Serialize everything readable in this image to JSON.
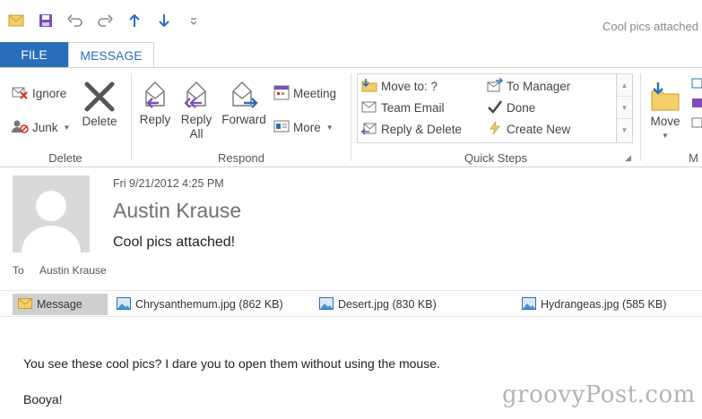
{
  "window": {
    "title": "Cool pics attached"
  },
  "tabs": {
    "file": "FILE",
    "message": "MESSAGE"
  },
  "ribbon": {
    "delete_group": {
      "label": "Delete",
      "ignore": "Ignore",
      "junk": "Junk",
      "delete": "Delete"
    },
    "respond_group": {
      "label": "Respond",
      "reply": "Reply",
      "reply_all_1": "Reply",
      "reply_all_2": "All",
      "forward": "Forward",
      "meeting": "Meeting",
      "more": "More"
    },
    "quick_steps": {
      "label": "Quick Steps",
      "move_to": "Move to: ?",
      "team_email": "Team Email",
      "reply_delete": "Reply & Delete",
      "to_manager": "To Manager",
      "done": "Done",
      "create_new": "Create New"
    },
    "move_group": {
      "move": "Move",
      "label_partial": "M"
    }
  },
  "header": {
    "date": "Fri 9/21/2012 4:25 PM",
    "sender": "Austin Krause",
    "subject": "Cool pics attached!",
    "to_label": "To",
    "to_name": "Austin Krause"
  },
  "attachments": [
    {
      "name": "Message"
    },
    {
      "name": "Chrysanthemum.jpg (862 KB)"
    },
    {
      "name": "Desert.jpg (830 KB)"
    },
    {
      "name": "Hydrangeas.jpg (585 KB)"
    }
  ],
  "body": {
    "line1": "You see these cool pics? I dare you to open them without using the mouse.",
    "line2": "Booya!"
  },
  "watermark": "groovyPost.com",
  "colors": {
    "accent": "#2a6ebb",
    "purple_arrow": "#7b4fb6"
  }
}
